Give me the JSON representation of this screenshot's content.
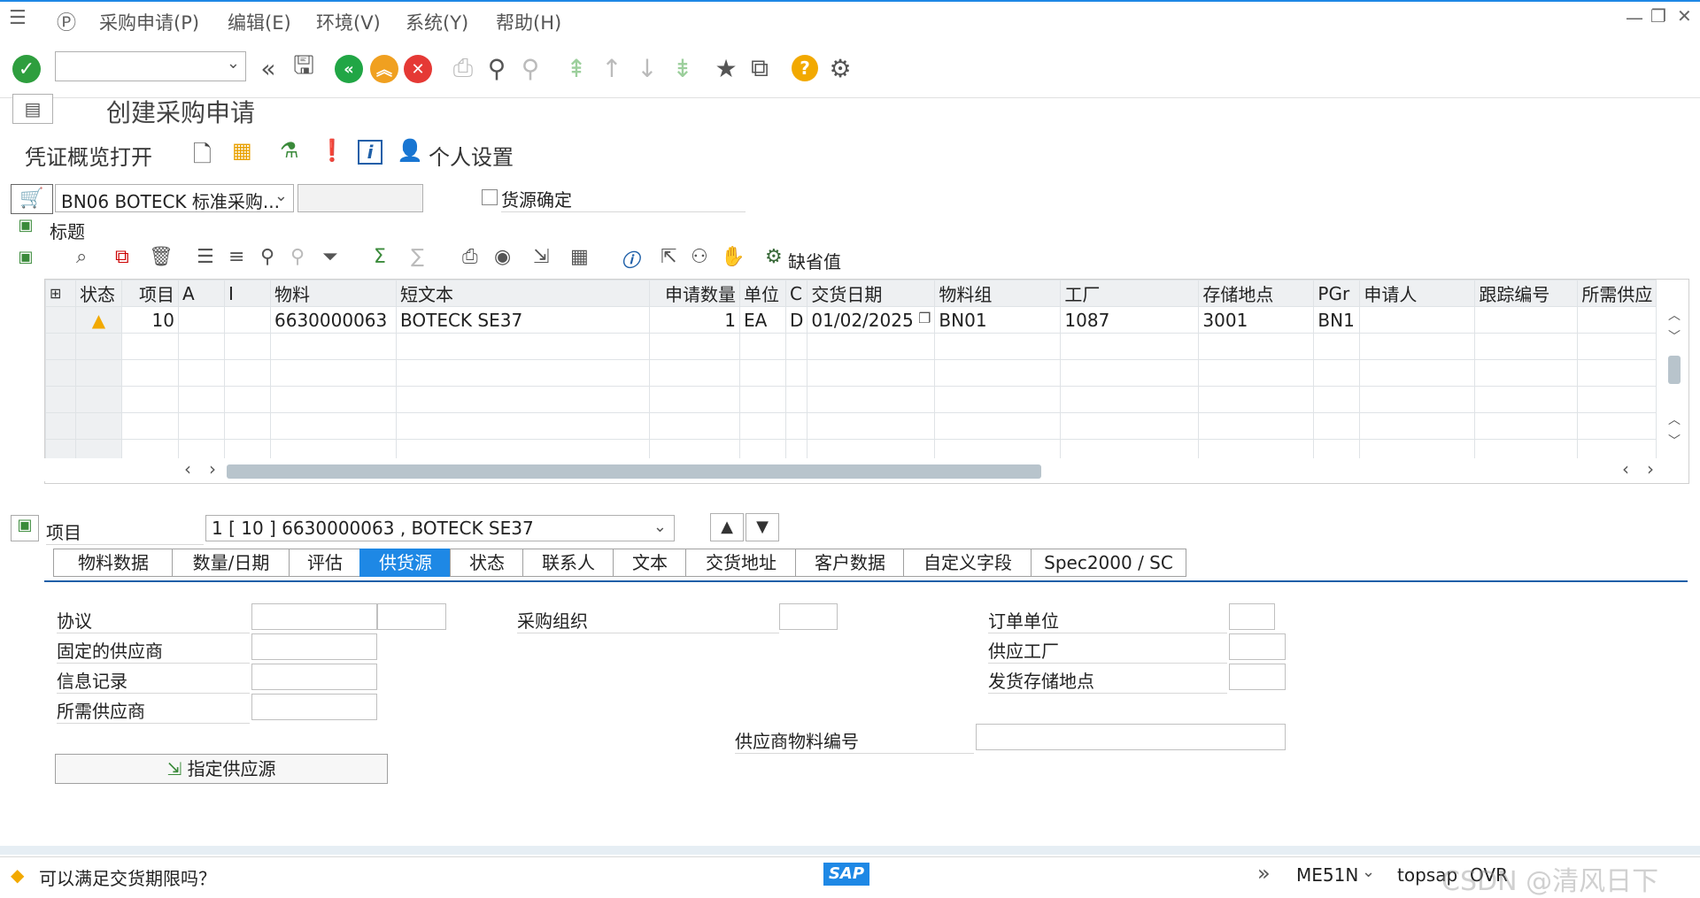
{
  "menu": {
    "items": [
      "采购申请(P)",
      "编辑(E)",
      "环境(V)",
      "系统(Y)",
      "帮助(H)"
    ]
  },
  "toolbar": {
    "command_field_value": "",
    "help_label": "?"
  },
  "title": "创建采购申请",
  "app_toolbar": {
    "doc_overview_label": "凭证概览打开",
    "personal_settings_label": "个人设置"
  },
  "header": {
    "doc_type_value": "BN06 BOTECK 标准采购...",
    "source_det_label": "货源确定",
    "title_label": "标题"
  },
  "grid_toolbar": {
    "default_values_label": "缺省值"
  },
  "grid": {
    "columns": [
      "状态",
      "项目",
      "A",
      "I",
      "物料",
      "短文本",
      "申请数量",
      "单位",
      "C",
      "交货日期",
      "物料组",
      "工厂",
      "存储地点",
      "PGr",
      "申请人",
      "跟踪编号",
      "所需供应"
    ],
    "rows": [
      {
        "status": "warning",
        "item": "10",
        "a": "",
        "i": "",
        "material": "6630000063",
        "short_text": "BOTECK SE37",
        "qty": "1",
        "unit": "EA",
        "c": "D",
        "delivery_date": "01/02/2025",
        "mat_group": "BN01",
        "plant": "1087",
        "storage": "3001",
        "pgr": "BN1",
        "requisitioner": "",
        "tracking": "",
        "desired_vendor": ""
      }
    ]
  },
  "item_section": {
    "label": "项目",
    "selected_item": "1 [ 10 ] 6630000063 , BOTECK SE37"
  },
  "tabs": [
    "物料数据",
    "数量/日期",
    "评估",
    "供货源",
    "状态",
    "联系人",
    "文本",
    "交货地址",
    "客户数据",
    "自定义字段",
    "Spec2000 / SC"
  ],
  "active_tab": "供货源",
  "source_tab": {
    "agreement_label": "协议",
    "fixed_vendor_label": "固定的供应商",
    "info_record_label": "信息记录",
    "desired_vendor_label": "所需供应商",
    "purch_org_label": "采购组织",
    "order_unit_label": "订单单位",
    "supplying_plant_label": "供应工厂",
    "issuing_sloc_label": "发货存储地点",
    "vendor_mat_no_label": "供应商物料编号",
    "assign_source_button": "指定供应源"
  },
  "statusbar": {
    "message": "可以满足交货期限吗？",
    "transaction": "ME51N",
    "server": "topsap",
    "mode": "OVR",
    "watermark": "CSDN @清风日下"
  },
  "colors": {
    "accent": "#1e88e5",
    "ok_green": "#2e9e3e",
    "back_green": "#21a645",
    "exit_orange": "#f0a020",
    "cancel_red": "#e53935",
    "warning_yellow": "#f2a900"
  }
}
